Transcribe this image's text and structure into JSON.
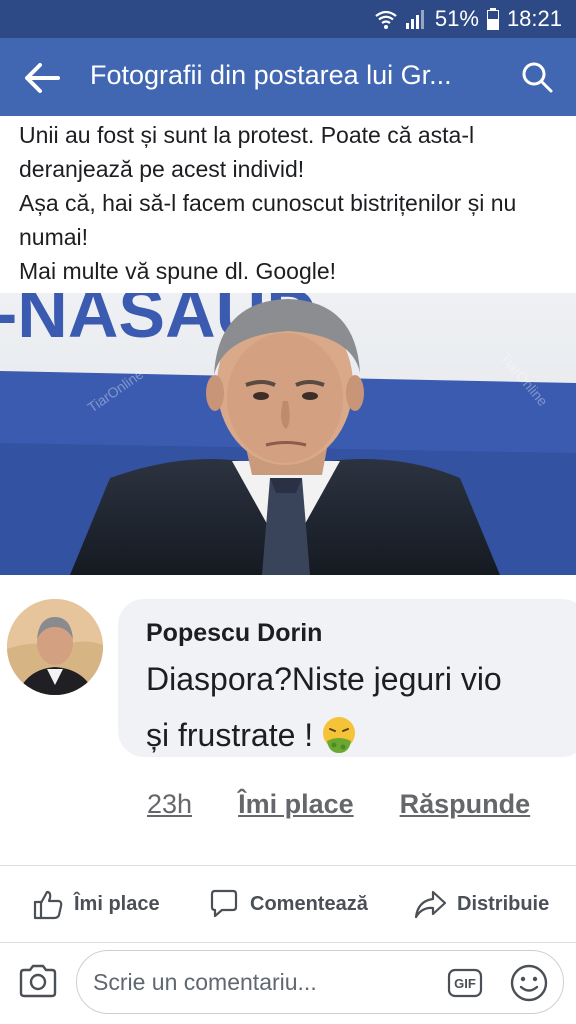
{
  "status_bar": {
    "battery": "51%",
    "time": "18:21"
  },
  "app_bar": {
    "title": "Fotografii din postarea lui Gr..."
  },
  "post": {
    "lines": [
      "Unii au fost și sunt la protest. Poate că asta-l deranjează pe acest individ!",
      "Așa că, hai să-l facem cunoscut bistrițenilor și nu numai!",
      "Mai multe vă spune dl. Google!"
    ],
    "photo_banner_text": "-NASAUD",
    "watermark": "TiarOnline"
  },
  "comment_screenshot": {
    "author": "Popescu Dorin",
    "line1": "Diaspora?Niste jeguri vio",
    "line2": "și frustrate !",
    "emoji": "nauseated-face",
    "time": "23h",
    "like": "Îmi place",
    "reply": "Răspunde"
  },
  "actions": {
    "like": "Îmi place",
    "comment": "Comentează",
    "share": "Distribuie"
  },
  "composer": {
    "placeholder": "Scrie un comentariu...",
    "gif": "GIF"
  },
  "colors": {
    "status_bar": "#2d4a86",
    "app_bar": "#4267b2",
    "banner_blue": "#3b5bb0"
  }
}
